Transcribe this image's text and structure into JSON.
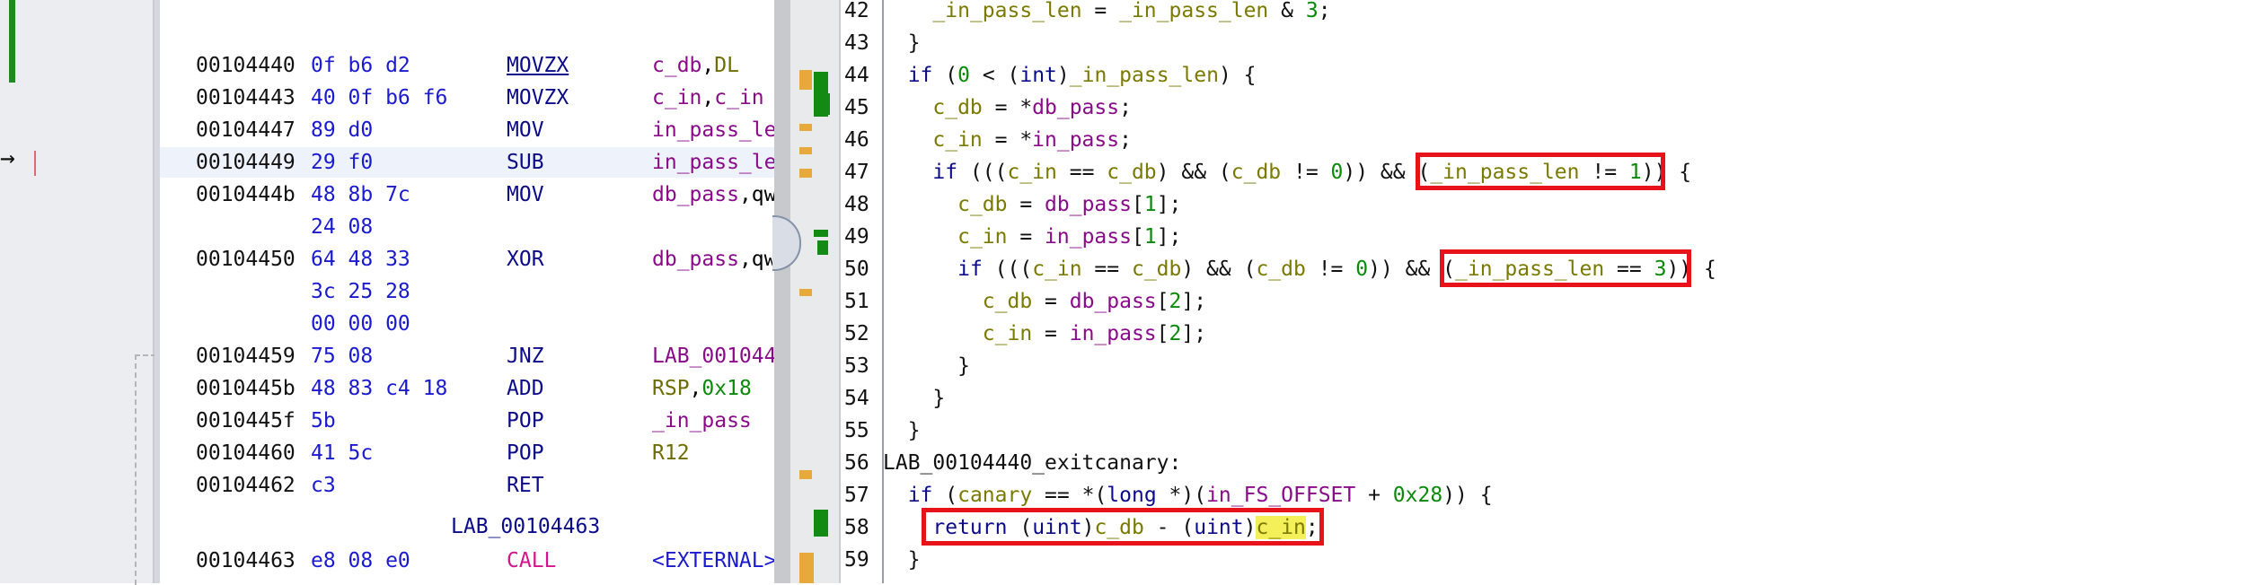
{
  "listing": {
    "rows": [
      {
        "addr": "00104440",
        "bytes": "0f b6 d2",
        "mnem": "MOVZX",
        "ops": [
          {
            "t": "c_db",
            "c": "db"
          },
          {
            "t": ",",
            "c": "plain"
          },
          {
            "t": "DL",
            "c": "olive"
          }
        ]
      },
      {
        "addr": "00104443",
        "bytes": "40 0f b6 f6",
        "mnem": "MOVZX",
        "ops": [
          {
            "t": "c_in",
            "c": "db"
          },
          {
            "t": ",",
            "c": "plain"
          },
          {
            "t": "c_in",
            "c": "db"
          }
        ]
      },
      {
        "addr": "00104447",
        "bytes": "89 d0",
        "mnem": "MOV",
        "ops": [
          {
            "t": "in_pass_le",
            "c": "db"
          }
        ]
      },
      {
        "addr": "00104449",
        "bytes": "29 f0",
        "mnem": "SUB",
        "ops": [
          {
            "t": "in_pass_le",
            "c": "db"
          }
        ]
      },
      {
        "addr": "0010444b",
        "bytes": "48 8b 7c",
        "mnem": "MOV",
        "ops": [
          {
            "t": "db_pass",
            "c": "db"
          },
          {
            "t": ",qw",
            "c": "plain"
          }
        ]
      },
      {
        "addr": "",
        "bytes": "24 08",
        "mnem": "",
        "ops": []
      },
      {
        "addr": "00104450",
        "bytes": "64 48 33",
        "mnem": "XOR",
        "ops": [
          {
            "t": "db_pass",
            "c": "db"
          },
          {
            "t": ",qw",
            "c": "plain"
          }
        ]
      },
      {
        "addr": "",
        "bytes": "3c 25 28",
        "mnem": "",
        "ops": []
      },
      {
        "addr": "",
        "bytes": "00 00 00",
        "mnem": "",
        "ops": []
      },
      {
        "addr": "00104459",
        "bytes": "75 08",
        "mnem": "JNZ",
        "ops": [
          {
            "t": "LAB_001044",
            "c": "db"
          }
        ]
      },
      {
        "addr": "0010445b",
        "bytes": "48 83 c4 18",
        "mnem": "ADD",
        "ops": [
          {
            "t": "RSP",
            "c": "olive"
          },
          {
            "t": ",",
            "c": "plain"
          },
          {
            "t": "0x18",
            "c": "num"
          }
        ]
      },
      {
        "addr": "0010445f",
        "bytes": "5b",
        "mnem": "POP",
        "ops": [
          {
            "t": "_in_pass",
            "c": "db"
          }
        ]
      },
      {
        "addr": "00104460",
        "bytes": "41 5c",
        "mnem": "POP",
        "ops": [
          {
            "t": "R12",
            "c": "olive"
          }
        ]
      },
      {
        "addr": "00104462",
        "bytes": "c3",
        "mnem": "RET",
        "ops": []
      }
    ],
    "label": "LAB_00104463",
    "last_row": {
      "addr": "00104463",
      "bytes": "e8 08 e0",
      "mnem": "CALL",
      "ops": [
        {
          "t": "<EXTERNAL>",
          "c": "ext"
        }
      ]
    }
  },
  "decompiler": {
    "lines": [
      {
        "n": "42",
        "parts": [
          {
            "t": "    "
          },
          {
            "t": "_in_pass_len",
            "c": "var"
          },
          {
            "t": " = "
          },
          {
            "t": "_in_pass_len",
            "c": "var"
          },
          {
            "t": " & "
          },
          {
            "t": "3",
            "c": "num"
          },
          {
            "t": ";"
          }
        ]
      },
      {
        "n": "43",
        "parts": [
          {
            "t": "  }"
          }
        ]
      },
      {
        "n": "44",
        "parts": [
          {
            "t": "  "
          },
          {
            "t": "if",
            "c": "kw"
          },
          {
            "t": " ("
          },
          {
            "t": "0",
            "c": "num"
          },
          {
            "t": " < ("
          },
          {
            "t": "int",
            "c": "kw"
          },
          {
            "t": ")"
          },
          {
            "t": "_in_pass_len",
            "c": "var"
          },
          {
            "t": ") {"
          }
        ]
      },
      {
        "n": "45",
        "parts": [
          {
            "t": "    "
          },
          {
            "t": "c_db",
            "c": "var"
          },
          {
            "t": " = *"
          },
          {
            "t": "db_pass",
            "c": "glob"
          },
          {
            "t": ";"
          }
        ]
      },
      {
        "n": "46",
        "parts": [
          {
            "t": "    "
          },
          {
            "t": "c_in",
            "c": "var"
          },
          {
            "t": " = *"
          },
          {
            "t": "in_pass",
            "c": "glob"
          },
          {
            "t": ";"
          }
        ]
      },
      {
        "n": "47",
        "parts": [
          {
            "t": "    "
          },
          {
            "t": "if",
            "c": "kw"
          },
          {
            "t": " ((("
          },
          {
            "t": "c_in",
            "c": "var"
          },
          {
            "t": " == "
          },
          {
            "t": "c_db",
            "c": "var"
          },
          {
            "t": ") && ("
          },
          {
            "t": "c_db",
            "c": "var"
          },
          {
            "t": " != "
          },
          {
            "t": "0",
            "c": "num"
          },
          {
            "t": ")) && ("
          },
          {
            "t": "_in_pass_len",
            "c": "var"
          },
          {
            "t": " != "
          },
          {
            "t": "1",
            "c": "num"
          },
          {
            "t": ")) {"
          }
        ]
      },
      {
        "n": "48",
        "parts": [
          {
            "t": "      "
          },
          {
            "t": "c_db",
            "c": "var"
          },
          {
            "t": " = "
          },
          {
            "t": "db_pass",
            "c": "glob"
          },
          {
            "t": "["
          },
          {
            "t": "1",
            "c": "num"
          },
          {
            "t": "];"
          }
        ]
      },
      {
        "n": "49",
        "parts": [
          {
            "t": "      "
          },
          {
            "t": "c_in",
            "c": "var"
          },
          {
            "t": " = "
          },
          {
            "t": "in_pass",
            "c": "glob"
          },
          {
            "t": "["
          },
          {
            "t": "1",
            "c": "num"
          },
          {
            "t": "];"
          }
        ]
      },
      {
        "n": "50",
        "parts": [
          {
            "t": "      "
          },
          {
            "t": "if",
            "c": "kw"
          },
          {
            "t": " ((("
          },
          {
            "t": "c_in",
            "c": "var"
          },
          {
            "t": " == "
          },
          {
            "t": "c_db",
            "c": "var"
          },
          {
            "t": ") && ("
          },
          {
            "t": "c_db",
            "c": "var"
          },
          {
            "t": " != "
          },
          {
            "t": "0",
            "c": "num"
          },
          {
            "t": ")) && ("
          },
          {
            "t": "_in_pass_len",
            "c": "var"
          },
          {
            "t": " == "
          },
          {
            "t": "3",
            "c": "num"
          },
          {
            "t": ")) {"
          }
        ]
      },
      {
        "n": "51",
        "parts": [
          {
            "t": "        "
          },
          {
            "t": "c_db",
            "c": "var"
          },
          {
            "t": " = "
          },
          {
            "t": "db_pass",
            "c": "glob"
          },
          {
            "t": "["
          },
          {
            "t": "2",
            "c": "num"
          },
          {
            "t": "];"
          }
        ]
      },
      {
        "n": "52",
        "parts": [
          {
            "t": "        "
          },
          {
            "t": "c_in",
            "c": "var"
          },
          {
            "t": " = "
          },
          {
            "t": "in_pass",
            "c": "glob"
          },
          {
            "t": "["
          },
          {
            "t": "2",
            "c": "num"
          },
          {
            "t": "];"
          }
        ]
      },
      {
        "n": "53",
        "parts": [
          {
            "t": "      }"
          }
        ]
      },
      {
        "n": "54",
        "parts": [
          {
            "t": "    }"
          }
        ]
      },
      {
        "n": "55",
        "parts": [
          {
            "t": "  }"
          }
        ]
      },
      {
        "n": "56",
        "parts": [
          {
            "t": "LAB_00104440_exitcanary:"
          }
        ]
      },
      {
        "n": "57",
        "parts": [
          {
            "t": "  "
          },
          {
            "t": "if",
            "c": "kw"
          },
          {
            "t": " ("
          },
          {
            "t": "canary",
            "c": "var"
          },
          {
            "t": " == *("
          },
          {
            "t": "long",
            "c": "kw"
          },
          {
            "t": " *)("
          },
          {
            "t": "in_FS_OFFSET",
            "c": "glob"
          },
          {
            "t": " + "
          },
          {
            "t": "0x28",
            "c": "num"
          },
          {
            "t": ")) {"
          }
        ]
      },
      {
        "n": "58",
        "parts": [
          {
            "t": "    "
          },
          {
            "t": "return",
            "c": "kw"
          },
          {
            "t": " ("
          },
          {
            "t": "uint",
            "c": "kw"
          },
          {
            "t": ")"
          },
          {
            "t": "c_db",
            "c": "var"
          },
          {
            "t": " - ("
          },
          {
            "t": "uint",
            "c": "kw"
          },
          {
            "t": ")"
          },
          {
            "t": "c_in",
            "c": "var hl"
          },
          {
            "t": ";"
          }
        ]
      },
      {
        "n": "59",
        "parts": [
          {
            "t": "  }"
          }
        ]
      }
    ]
  }
}
